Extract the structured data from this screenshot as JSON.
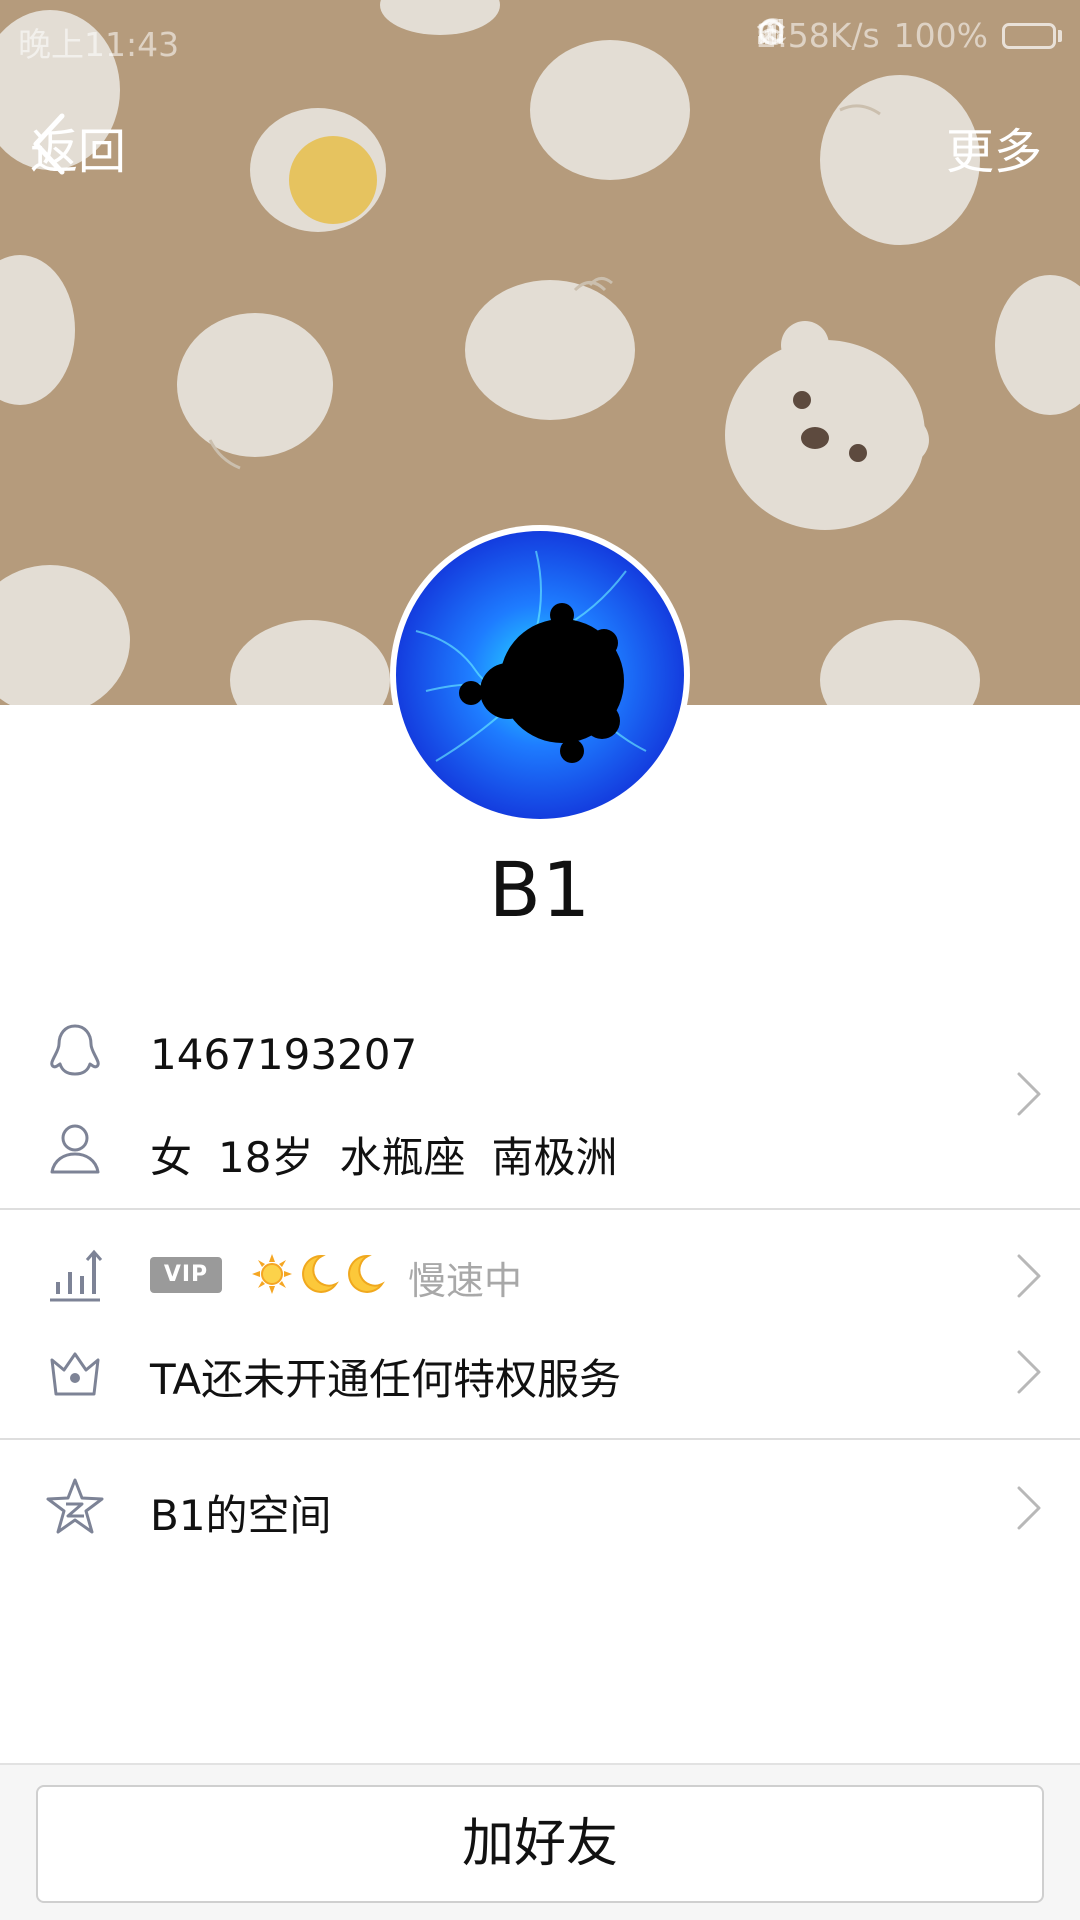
{
  "status_bar": {
    "time": "晚上11:43",
    "net_speed": "2.58K/s",
    "battery": "100%",
    "battery_level": 1.0
  },
  "nav": {
    "back_label": "返回",
    "more_label": "更多"
  },
  "profile": {
    "name": "B1",
    "qq_number": "1467193207",
    "gender": "女",
    "age": "18岁",
    "zodiac": "水瓶座",
    "location": "南极洲"
  },
  "level": {
    "vip_badge": "VIP",
    "icons": [
      "sun-icon",
      "moon-icon",
      "moon-icon"
    ],
    "status": "慢速中"
  },
  "privilege": {
    "text": "TA还未开通任何特权服务"
  },
  "space": {
    "label": "B1的空间"
  },
  "actions": {
    "add_friend": "加好友"
  },
  "colors": {
    "cover_bg": "#b59b7c",
    "icon_gray": "#7d8396",
    "text_primary": "#111111",
    "text_muted": "#a8a8a8"
  }
}
